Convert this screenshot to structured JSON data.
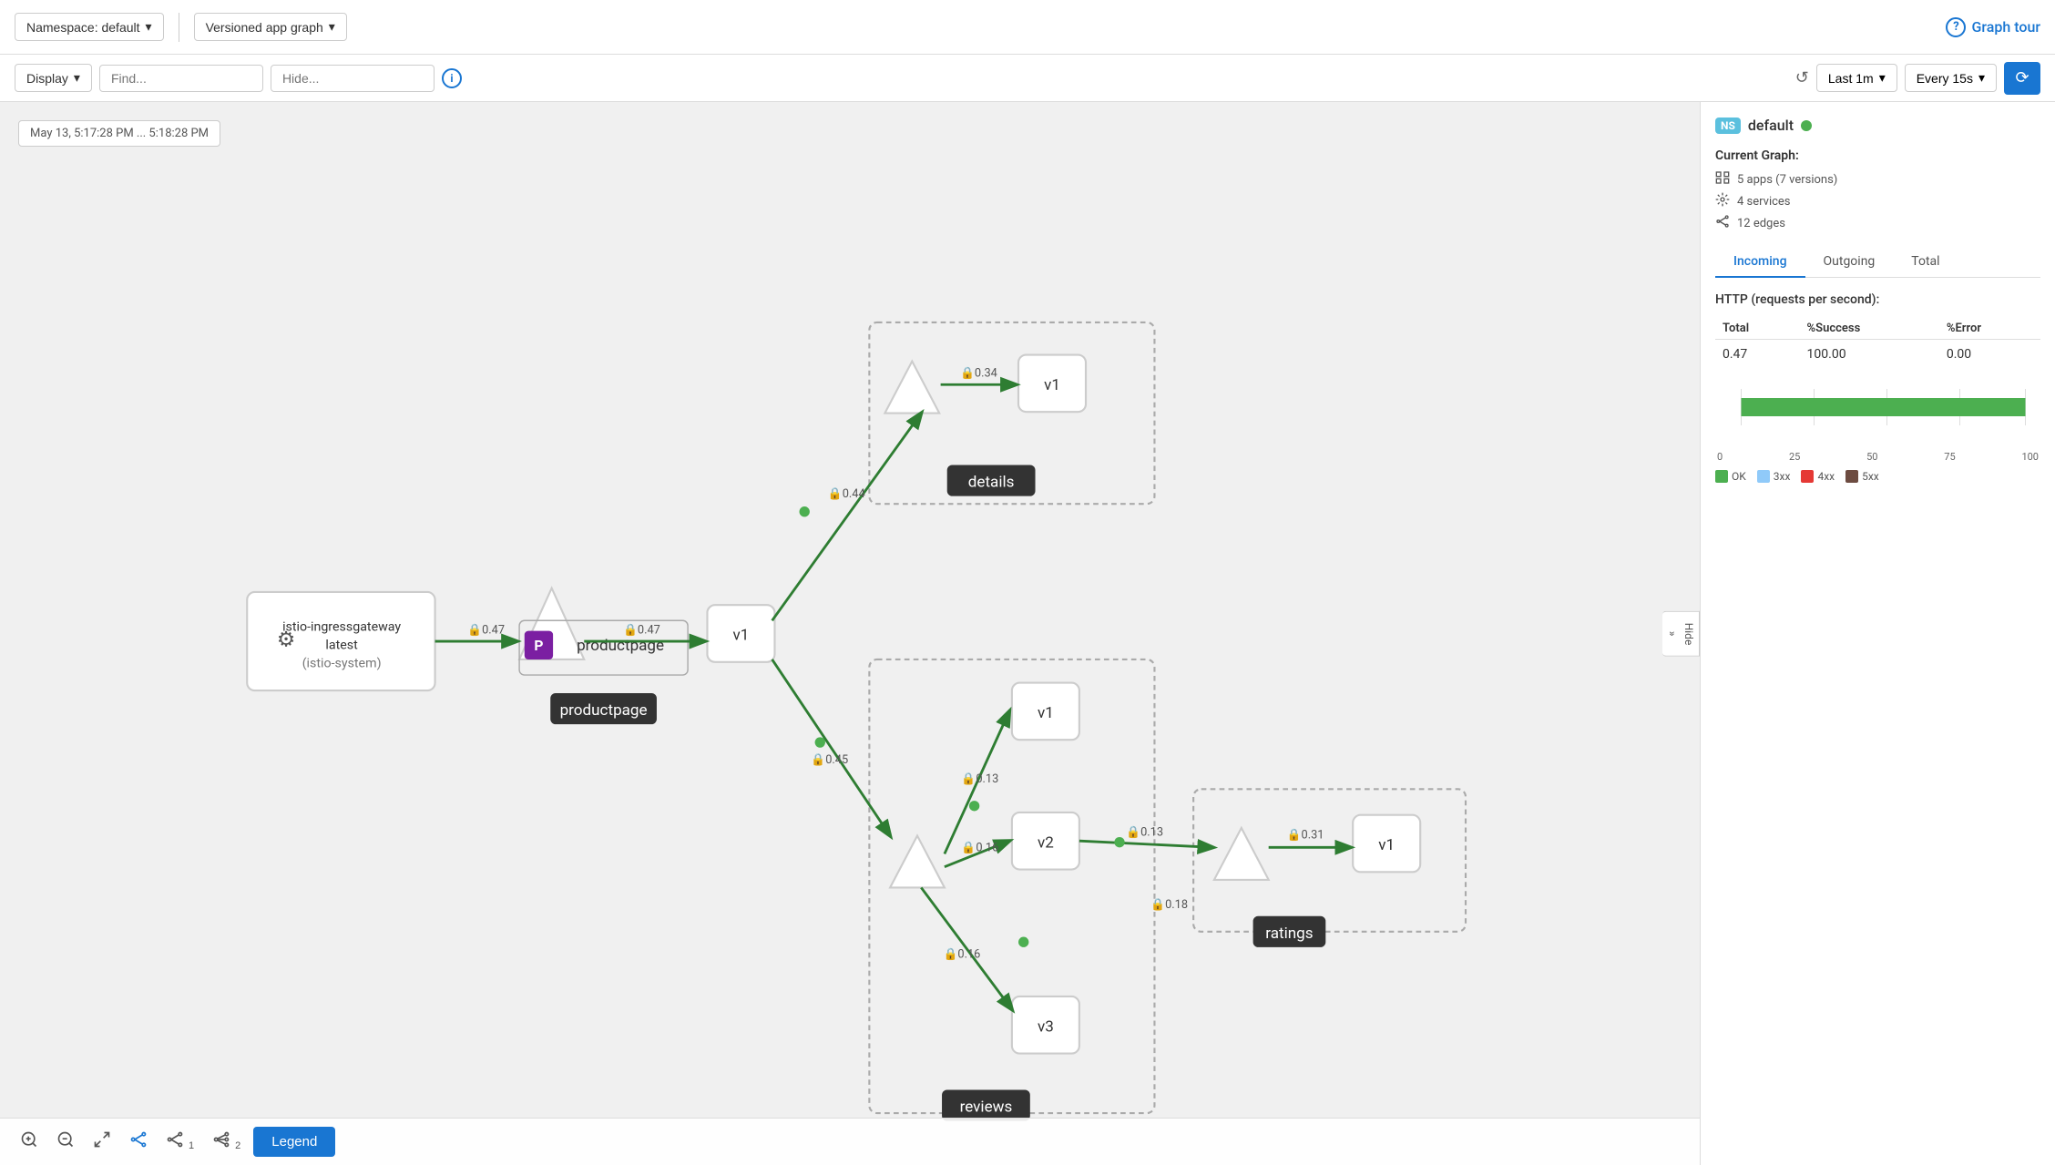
{
  "toolbar": {
    "namespace_label": "Namespace: default",
    "graph_type_label": "Versioned app graph",
    "graph_tour_label": "Graph tour",
    "display_label": "Display",
    "find_placeholder": "Find...",
    "hide_placeholder": "Hide...",
    "time_label": "Last 1m",
    "interval_label": "Every 15s"
  },
  "graph": {
    "timestamp": "May 13, 5:17:28 PM ... 5:18:28 PM",
    "hide_label": "Hide"
  },
  "bottom_toolbar": {
    "legend_label": "Legend",
    "badge1": "1",
    "badge2": "2"
  },
  "right_panel": {
    "ns_badge": "NS",
    "ns_name": "default",
    "current_graph_title": "Current Graph:",
    "apps": "5 apps (7 versions)",
    "services": "4 services",
    "edges": "12 edges",
    "tab_incoming": "Incoming",
    "tab_outgoing": "Outgoing",
    "tab_total": "Total",
    "http_title": "HTTP (requests per second):",
    "col_total": "Total",
    "col_success": "%Success",
    "col_error": "%Error",
    "val_total": "0.47",
    "val_success": "100.00",
    "val_error": "0.00",
    "axis_0": "0",
    "axis_25": "25",
    "axis_50": "50",
    "axis_75": "75",
    "axis_100": "100",
    "legend_ok": "OK",
    "legend_3xx": "3xx",
    "legend_4xx": "4xx",
    "legend_5xx": "5xx"
  }
}
